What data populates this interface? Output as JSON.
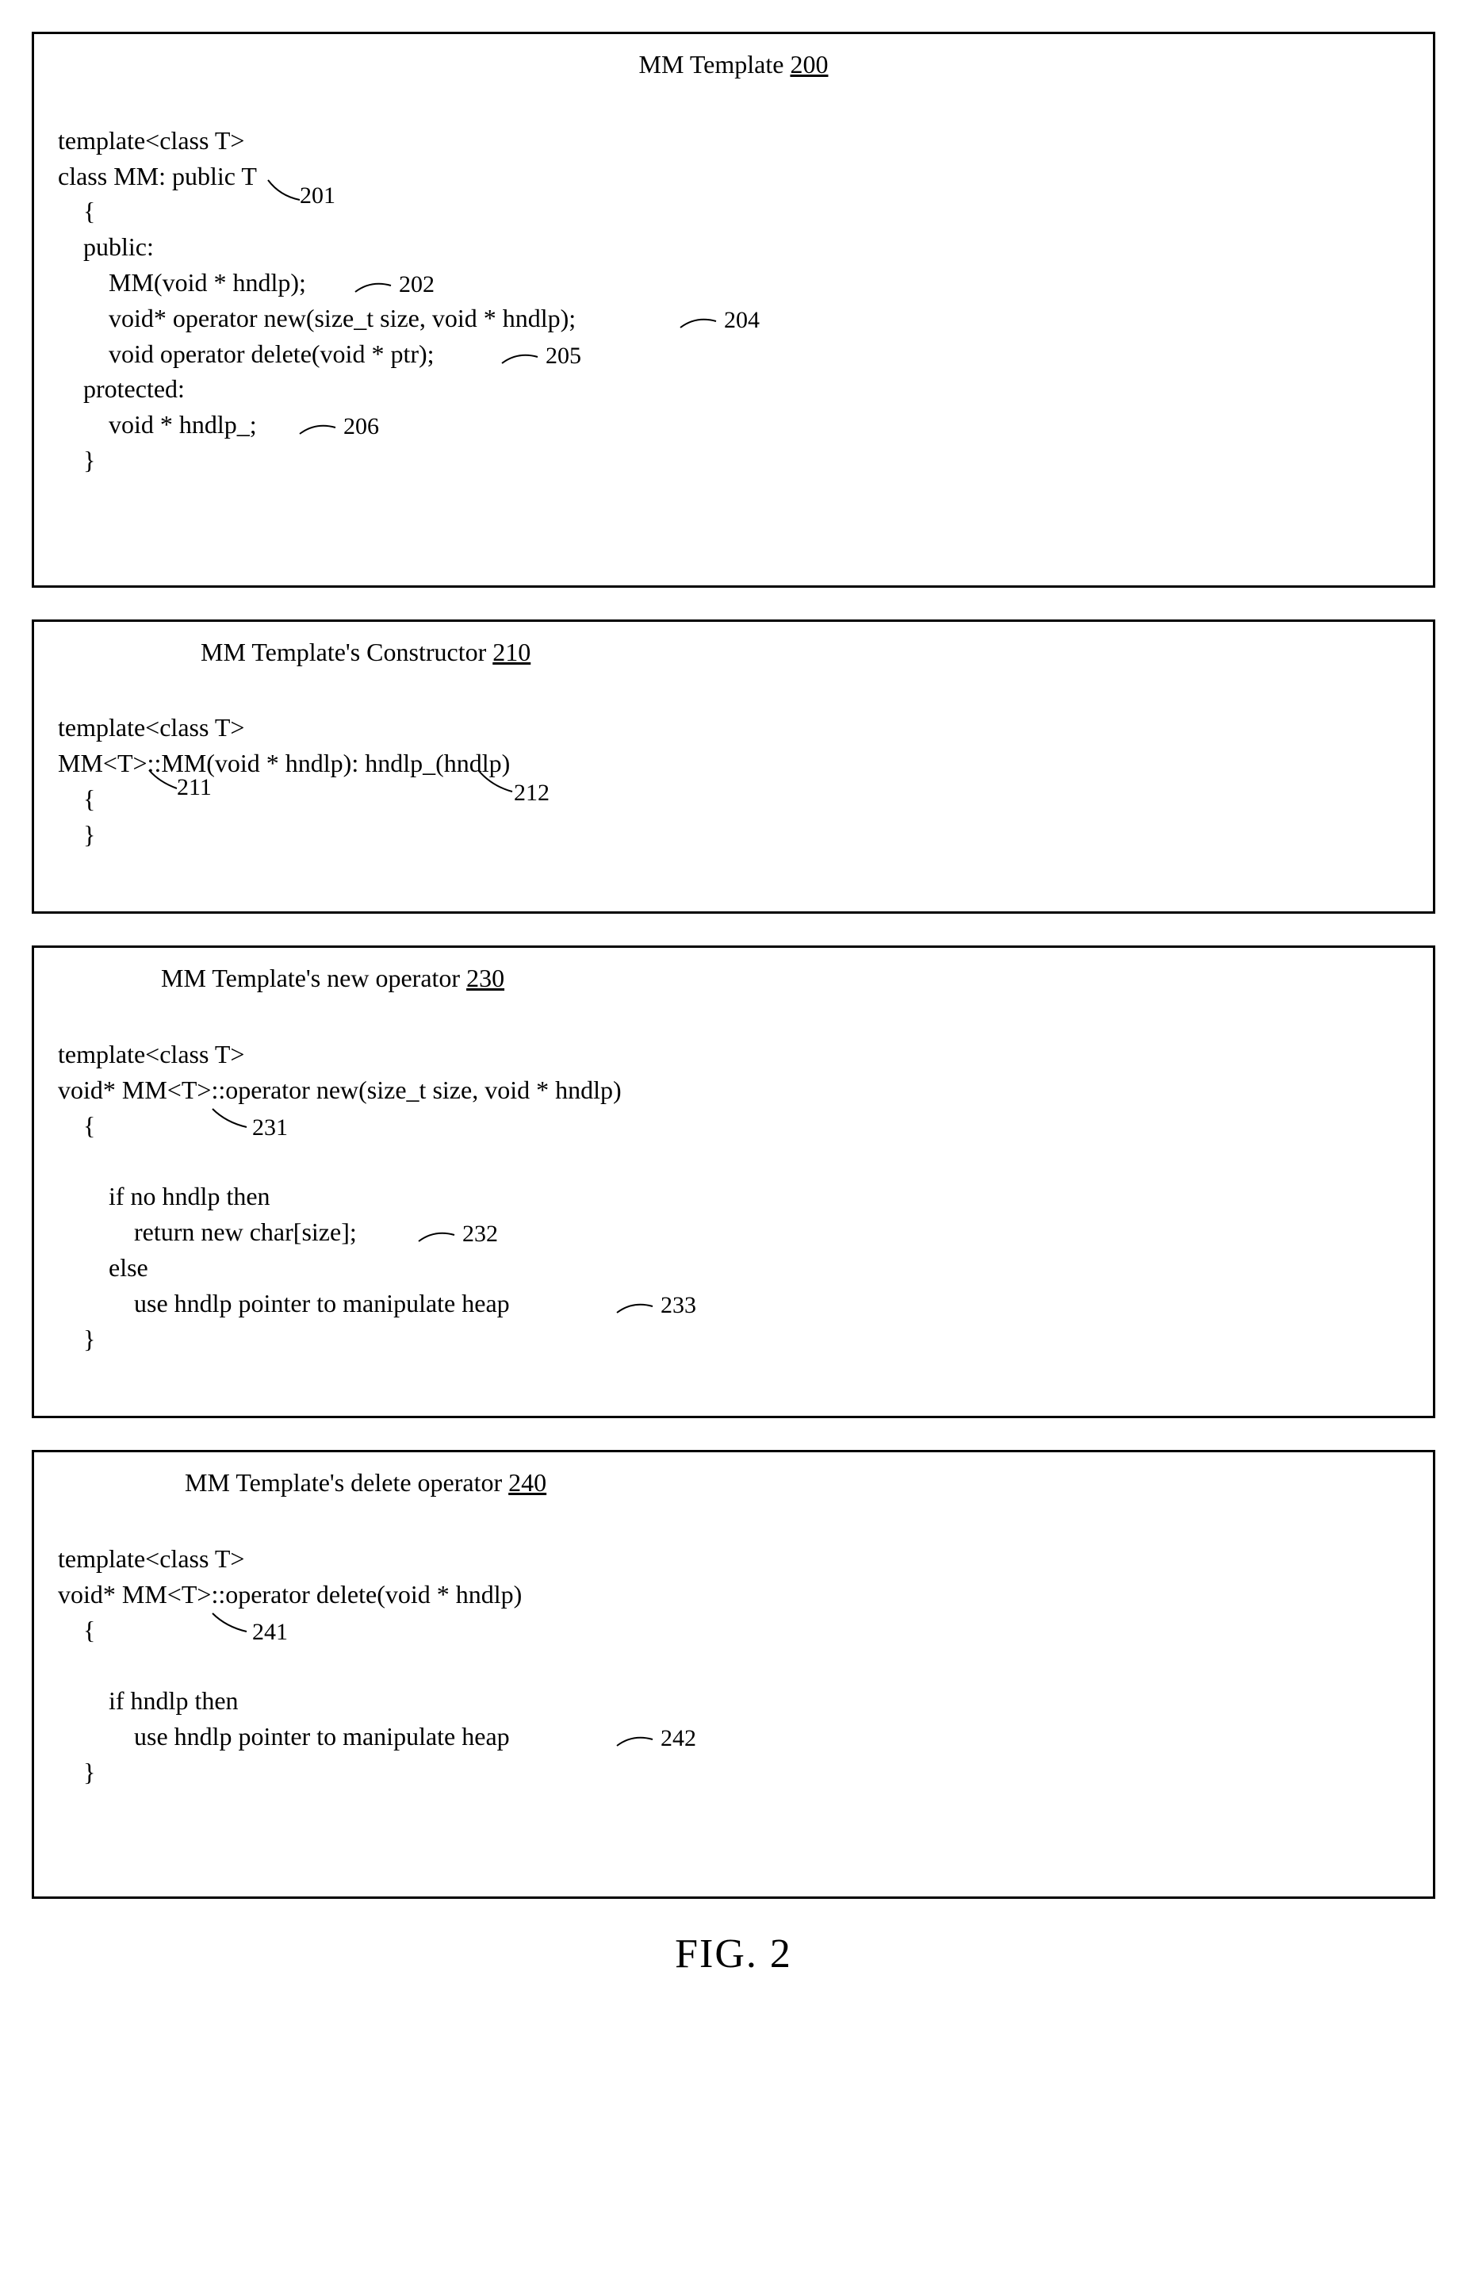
{
  "figure_label": "FIG. 2",
  "panel1": {
    "title_prefix": "MM Template ",
    "title_ref": "200",
    "line1": "template<class T>",
    "line2a": "class MM: public T",
    "ref201": "201",
    "line3": "    {",
    "line4": "    public:",
    "line5a": "        MM(void * hndlp);",
    "ref202": "202",
    "line6a": "        void* operator new(size_t size, void * hndlp);",
    "ref204": "204",
    "line7a": "        void operator delete(void * ptr);",
    "ref205": "205",
    "line8": "    protected:",
    "line9a": "        void * hndlp_;",
    "ref206": "206",
    "line10": "    }"
  },
  "panel2": {
    "title_prefix": "MM Template's Constructor ",
    "title_ref": "210",
    "line1": "template<class T>",
    "line2": "MM<T>::MM(void * hndlp): hndlp_(hndlp)",
    "ref211": "211",
    "ref212": "212",
    "line3": "    {",
    "line4": "    }"
  },
  "panel3": {
    "title_prefix": "MM Template's new operator ",
    "title_ref": "230",
    "line1": "template<class T>",
    "line2": "void* MM<T>::operator new(size_t size, void * hndlp)",
    "line3": "    {",
    "ref231": "231",
    "line5": "        if no hndlp then",
    "line6a": "            return new char[size];",
    "ref232": "232",
    "line7": "        else",
    "line8a": "            use hndlp pointer to manipulate heap",
    "ref233": "233",
    "line9": "    }"
  },
  "panel4": {
    "title_prefix": "MM Template's delete operator ",
    "title_ref": "240",
    "line1": "template<class T>",
    "line2": "void* MM<T>::operator delete(void * hndlp)",
    "line3": "    {",
    "ref241": "241",
    "line5": "        if hndlp then",
    "line6a": "            use hndlp pointer to manipulate heap",
    "ref242": "242",
    "line7": "    }"
  }
}
